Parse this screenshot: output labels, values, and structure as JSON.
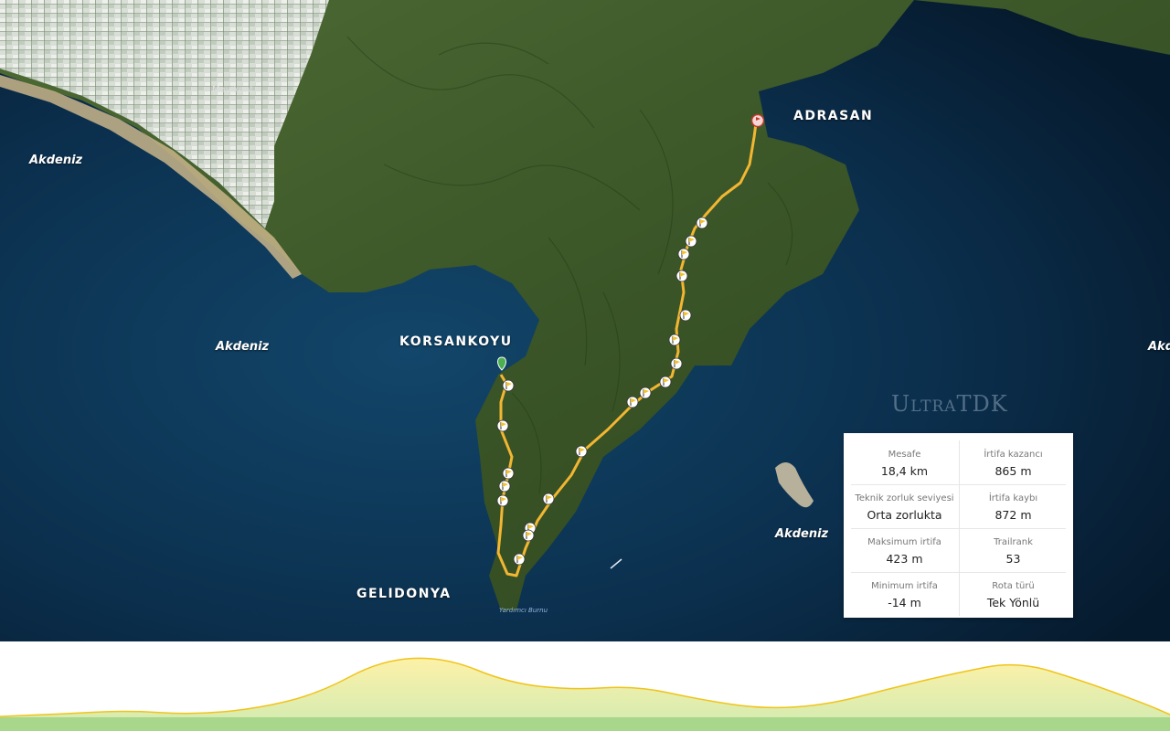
{
  "map": {
    "labels": {
      "adrasan": "ADRASAN",
      "korsankoyu": "KORSANKOYU",
      "gelidonya": "GELIDONYA",
      "sea_left_top": "Akdeniz",
      "sea_left_mid": "Akdeniz",
      "sea_right": "Akdeniz",
      "sea_edge": "Akd",
      "village": "Mavikent",
      "cape": "Yardımcı Burnu"
    },
    "watermark": "UltraTDK",
    "icons": {
      "start": "green-start-pin-icon",
      "end": "red-finish-flag-icon",
      "waypoint": "yellow-flag-icon"
    },
    "colors": {
      "route": "#f2b632",
      "sea": "#0d3553",
      "land": "#3e5a2a"
    }
  },
  "stats": {
    "distance_label": "Mesafe",
    "distance_value": "18,4 km",
    "gain_label": "İrtifa kazancı",
    "gain_value": "865 m",
    "tech_label": "Teknik zorluk seviyesi",
    "tech_value": "Orta zorlukta",
    "loss_label": "İrtifa kaybı",
    "loss_value": "872 m",
    "max_label": "Maksimum irtifa",
    "max_value": "423 m",
    "trailrank_label": "Trailrank",
    "trailrank_value": "53",
    "min_label": "Minimum irtifa",
    "min_value": "-14 m",
    "type_label": "Rota türü",
    "type_value": "Tek Yönlü"
  },
  "profile": {
    "colors": {
      "line": "#f0c419",
      "fill_top": "#fdf1a8",
      "fill_bottom": "#d8ecb0",
      "base": "#a8d68a"
    },
    "distance_km": [
      0,
      1,
      2,
      3,
      4,
      5,
      6,
      7,
      8,
      9,
      10,
      11,
      12,
      13,
      14,
      15,
      16,
      17,
      18,
      18.4
    ],
    "altitude_m": [
      -14,
      5,
      30,
      0,
      40,
      150,
      400,
      420,
      230,
      180,
      210,
      110,
      40,
      70,
      190,
      300,
      390,
      250,
      80,
      0
    ]
  }
}
